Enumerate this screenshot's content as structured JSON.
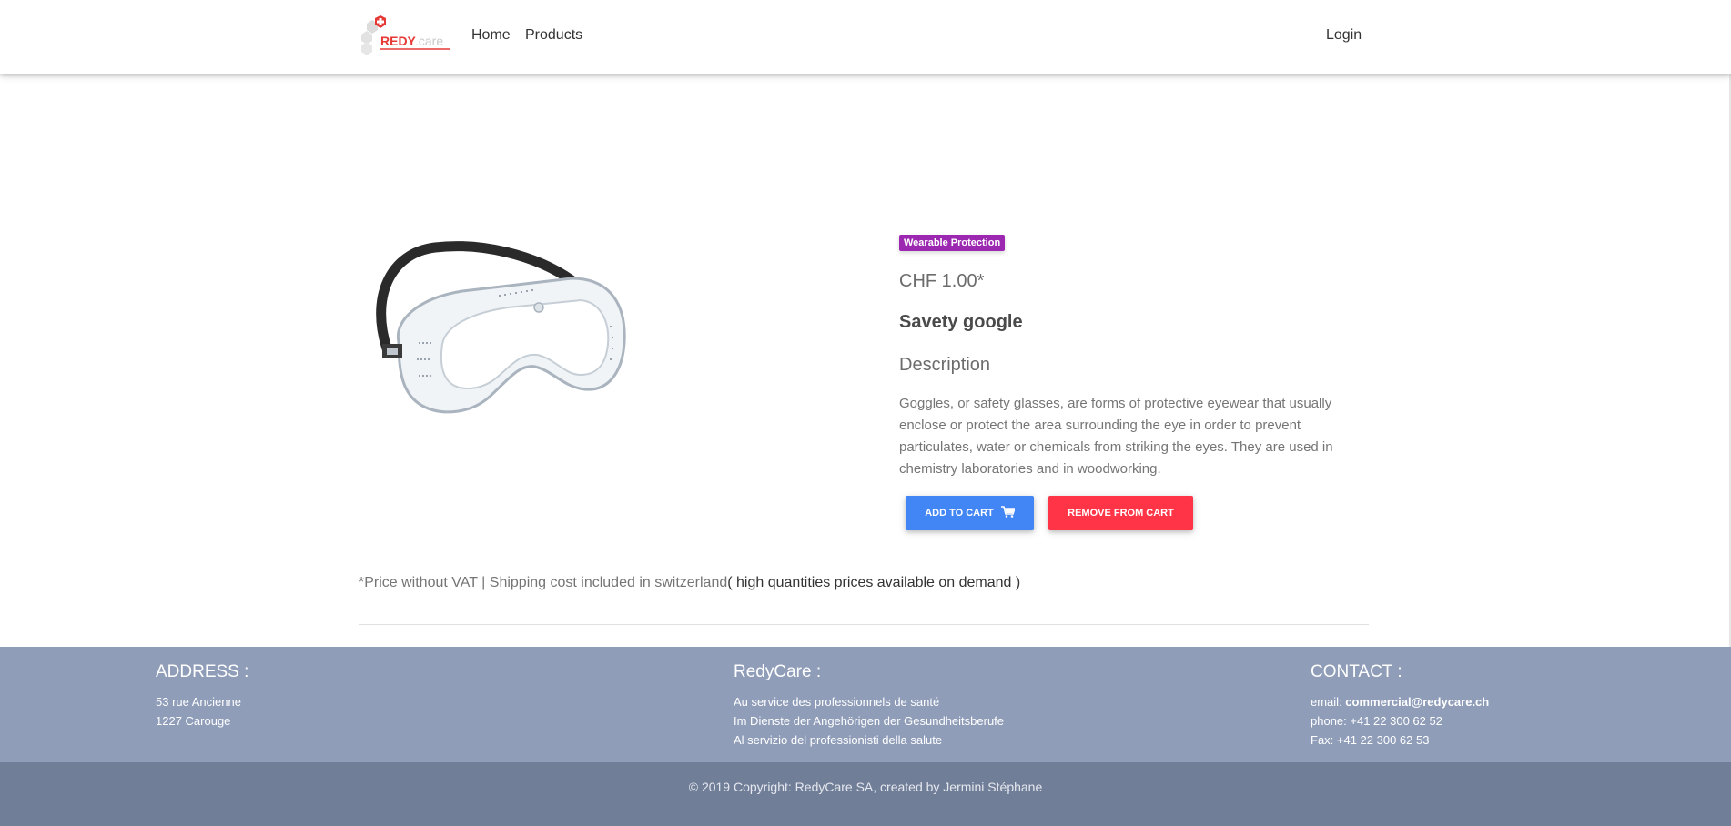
{
  "nav": {
    "brand_name": "REDY.care",
    "home": "Home",
    "products": "Products",
    "login": "Login"
  },
  "product": {
    "category_badge": "Wearable Protection",
    "price": "CHF 1.00*",
    "title": "Savety google",
    "description_heading": "Description",
    "description": "Goggles, or safety glasses, are forms of protective eyewear that usually enclose or protect the area surrounding the eye in order to prevent particulates, water or chemicals from striking the eyes. They are used in chemistry laboratories and in woodworking.",
    "add_to_cart": "Add to cart",
    "remove_from_cart": "Remove from cart",
    "cart_icon": "cart-icon",
    "vat_note": "*Price without VAT | Shipping cost included in switzerland",
    "vat_note_strong": "( high quantities prices available on demand )"
  },
  "footer": {
    "address": {
      "heading": "ADDRESS :",
      "line1": "53 rue Ancienne",
      "line2": "1227 Carouge"
    },
    "redycare": {
      "heading": "RedyCare :",
      "line1": "Au service des professionnels de santé",
      "line2": "Im Dienste der Angehörigen der Gesundheitsberufe",
      "line3": "Al servizio del professionisti della salute"
    },
    "contact": {
      "heading": "CONTACT :",
      "email_label": "email: ",
      "email": "commercial@redycare.ch",
      "phone": "phone: +41 22 300 62 52",
      "fax": "Fax: +41 22 300 62 53"
    },
    "copyright": "© 2019 Copyright: RedyCare SA, created by Jermini Stéphane"
  },
  "colors": {
    "badge": "#9c27b0",
    "add_button": "#4285f4",
    "remove_button": "#ff3547",
    "footer": "#8f9db9",
    "copyright_bar": "#717e98",
    "brand_red": "#e53935"
  }
}
